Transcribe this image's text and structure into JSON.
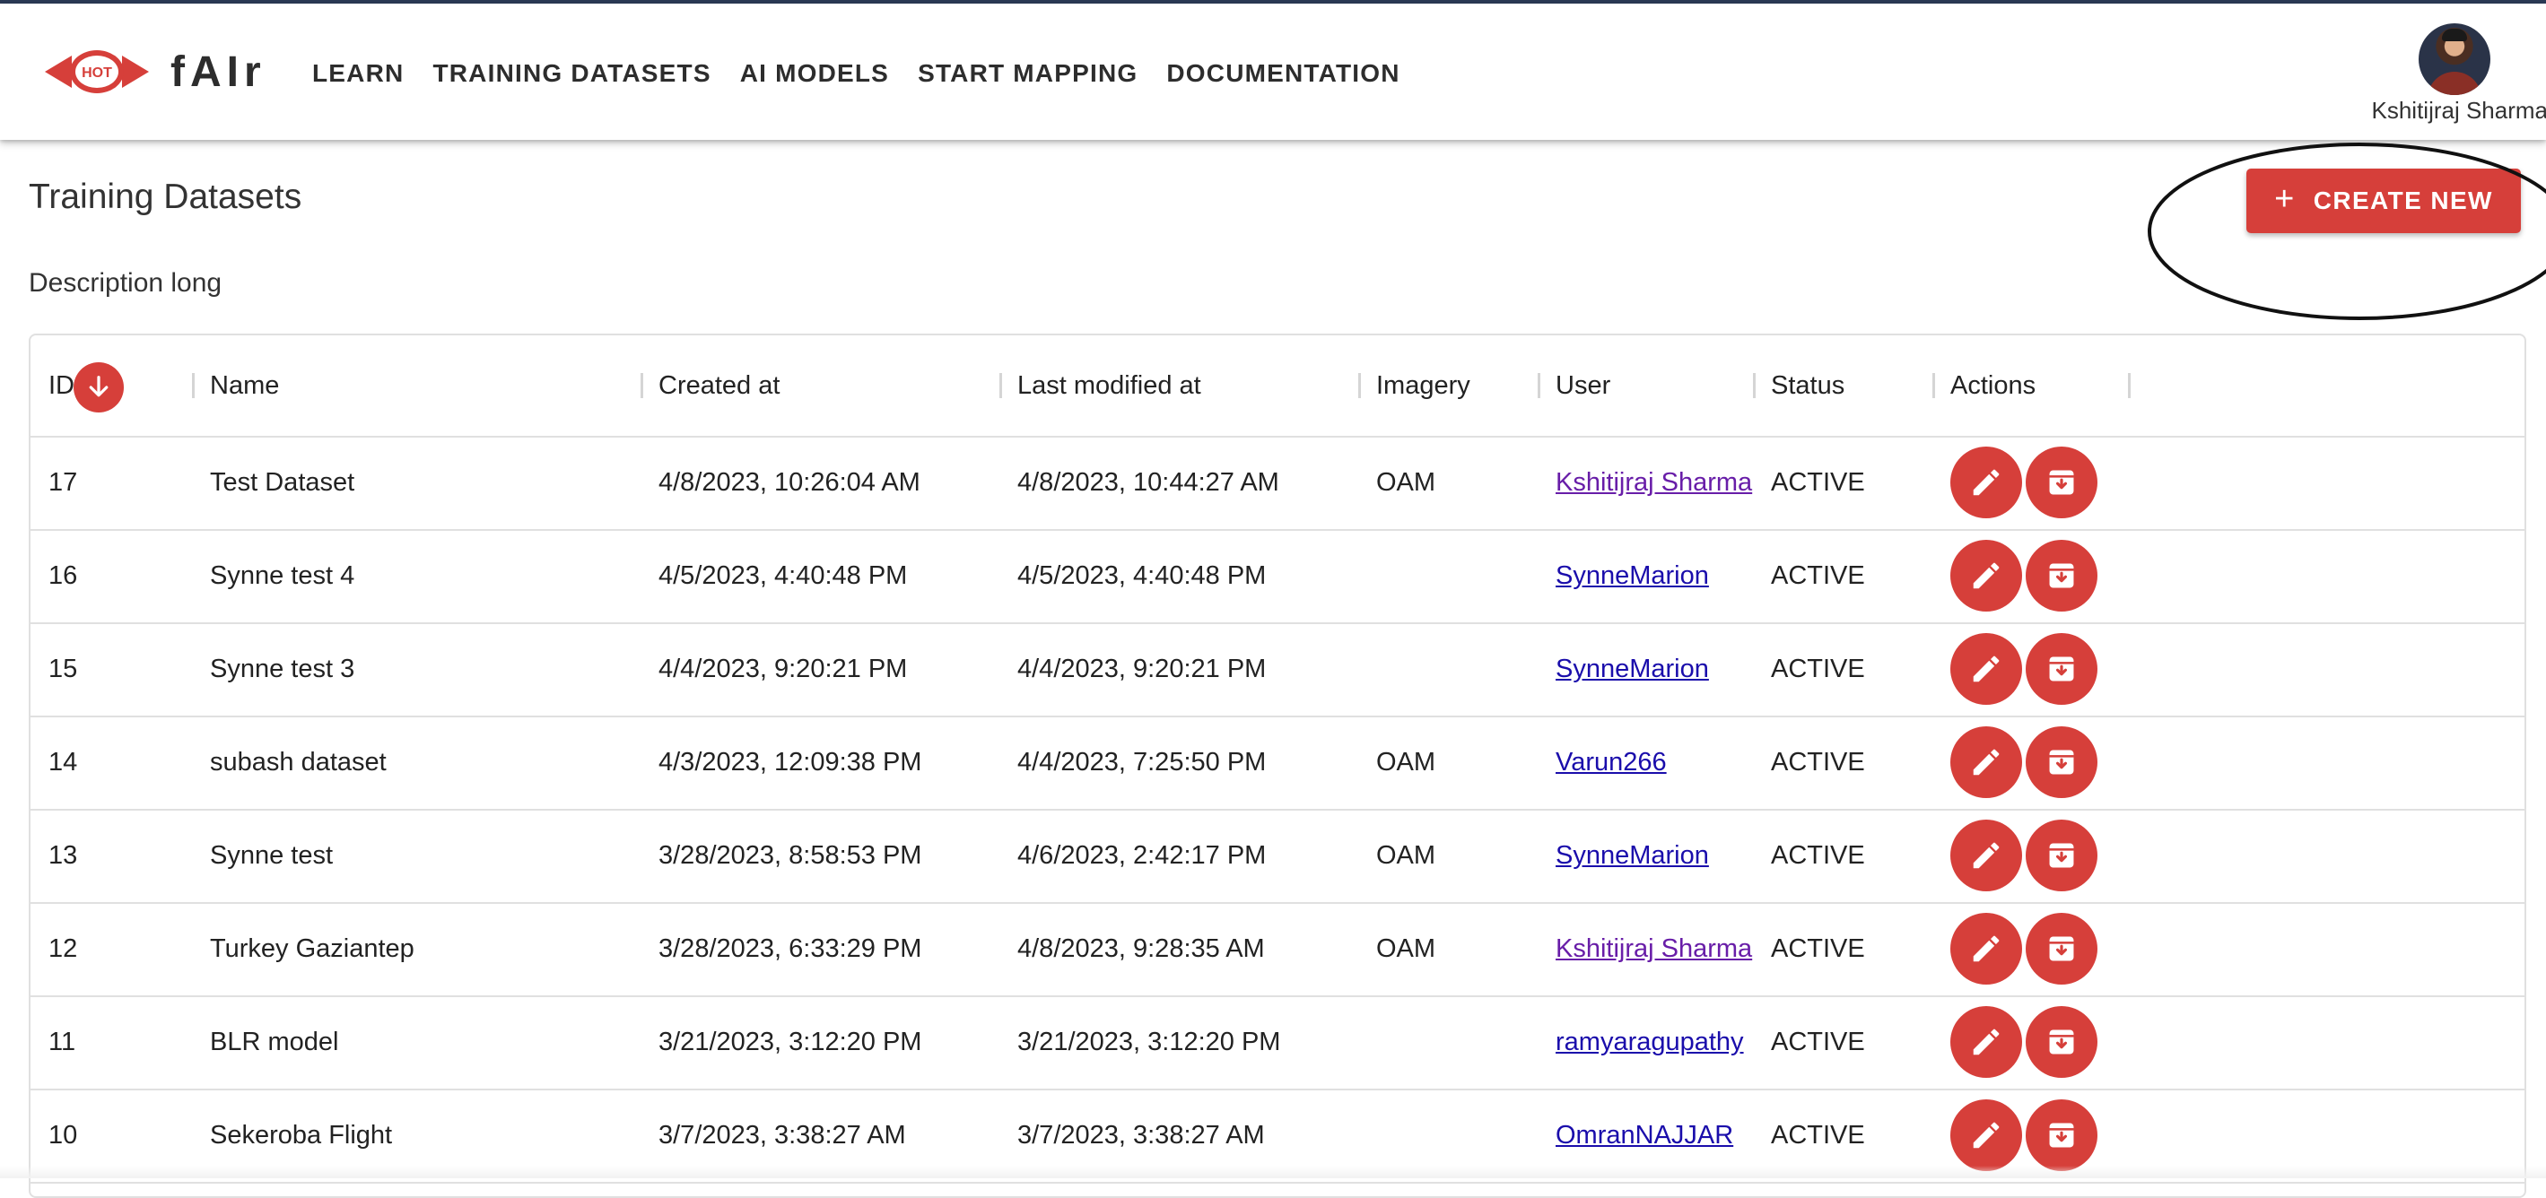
{
  "app": {
    "brand": "fAIr",
    "logo_text": "HOT"
  },
  "nav": [
    {
      "label": "LEARN"
    },
    {
      "label": "TRAINING DATASETS"
    },
    {
      "label": "AI MODELS"
    },
    {
      "label": "START MAPPING"
    },
    {
      "label": "DOCUMENTATION"
    }
  ],
  "user": {
    "name": "Kshitijraj Sharma"
  },
  "page": {
    "title": "Training Datasets",
    "description": "Description long",
    "create_button": "CREATE NEW"
  },
  "table": {
    "columns": [
      "ID",
      "Name",
      "Created at",
      "Last modified at",
      "Imagery",
      "User",
      "Status",
      "Actions"
    ],
    "sort": {
      "column": "ID",
      "direction": "descending"
    },
    "rows": [
      {
        "id": "17",
        "name": "Test Dataset",
        "created": "4/8/2023, 10:26:04 AM",
        "modified": "4/8/2023, 10:44:27 AM",
        "imagery": "OAM",
        "user": "Kshitijraj Sharma",
        "visited": true,
        "status": "ACTIVE"
      },
      {
        "id": "16",
        "name": "Synne test 4",
        "created": "4/5/2023, 4:40:48 PM",
        "modified": "4/5/2023, 4:40:48 PM",
        "imagery": "",
        "user": "SynneMarion",
        "visited": false,
        "status": "ACTIVE"
      },
      {
        "id": "15",
        "name": "Synne test 3",
        "created": "4/4/2023, 9:20:21 PM",
        "modified": "4/4/2023, 9:20:21 PM",
        "imagery": "",
        "user": "SynneMarion",
        "visited": false,
        "status": "ACTIVE"
      },
      {
        "id": "14",
        "name": "subash dataset",
        "created": "4/3/2023, 12:09:38 PM",
        "modified": "4/4/2023, 7:25:50 PM",
        "imagery": "OAM",
        "user": "Varun266",
        "visited": false,
        "status": "ACTIVE"
      },
      {
        "id": "13",
        "name": "Synne test",
        "created": "3/28/2023, 8:58:53 PM",
        "modified": "4/6/2023, 2:42:17 PM",
        "imagery": "OAM",
        "user": "SynneMarion",
        "visited": false,
        "status": "ACTIVE"
      },
      {
        "id": "12",
        "name": "Turkey Gaziantep",
        "created": "3/28/2023, 6:33:29 PM",
        "modified": "4/8/2023, 9:28:35 AM",
        "imagery": "OAM",
        "user": "Kshitijraj Sharma",
        "visited": true,
        "status": "ACTIVE"
      },
      {
        "id": "11",
        "name": "BLR model",
        "created": "3/21/2023, 3:12:20 PM",
        "modified": "3/21/2023, 3:12:20 PM",
        "imagery": "",
        "user": "ramyaragupathy",
        "visited": false,
        "status": "ACTIVE"
      },
      {
        "id": "10",
        "name": "Sekeroba Flight",
        "created": "3/7/2023, 3:38:27 AM",
        "modified": "3/7/2023, 3:38:27 AM",
        "imagery": "",
        "user": "OmranNAJJAR",
        "visited": false,
        "status": "ACTIVE"
      }
    ],
    "row_actions": [
      {
        "icon": "pencil-icon"
      },
      {
        "icon": "archive-icon"
      }
    ]
  },
  "colors": {
    "accent": "#d63f3a",
    "link": "#1a0dab",
    "link_visited": "#681da8",
    "text": "#212121"
  }
}
